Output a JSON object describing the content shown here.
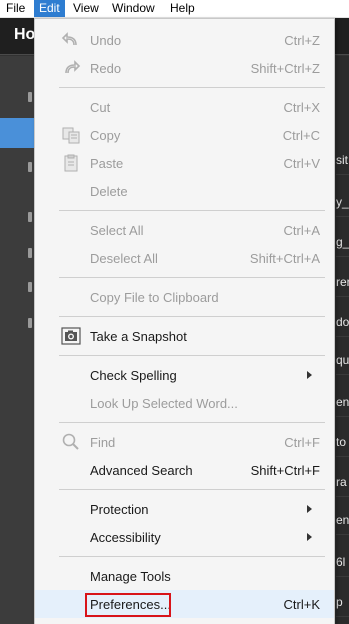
{
  "menubar": {
    "items": [
      "File",
      "Edit",
      "View",
      "Window",
      "Help"
    ]
  },
  "app": {
    "home_tab_label": "Ho",
    "right_fragments": [
      "sit",
      "y_",
      "g_",
      "ren",
      "do",
      "qu",
      "en",
      "to",
      "ra",
      "en",
      "6l",
      "p",
      "p",
      "en"
    ]
  },
  "menu": {
    "undo": {
      "label": "Undo",
      "shortcut": "Ctrl+Z"
    },
    "redo": {
      "label": "Redo",
      "shortcut": "Shift+Ctrl+Z"
    },
    "cut": {
      "label": "Cut",
      "shortcut": "Ctrl+X"
    },
    "copy": {
      "label": "Copy",
      "shortcut": "Ctrl+C"
    },
    "paste": {
      "label": "Paste",
      "shortcut": "Ctrl+V"
    },
    "delete": {
      "label": "Delete"
    },
    "select_all": {
      "label": "Select All",
      "shortcut": "Ctrl+A"
    },
    "deselect_all": {
      "label": "Deselect All",
      "shortcut": "Shift+Ctrl+A"
    },
    "copy_file": {
      "label": "Copy File to Clipboard"
    },
    "snapshot": {
      "label": "Take a Snapshot"
    },
    "check_spelling": {
      "label": "Check Spelling"
    },
    "look_up": {
      "label": "Look Up Selected Word..."
    },
    "find": {
      "label": "Find",
      "shortcut": "Ctrl+F"
    },
    "advanced_search": {
      "label": "Advanced Search",
      "shortcut": "Shift+Ctrl+F"
    },
    "protection": {
      "label": "Protection"
    },
    "accessibility": {
      "label": "Accessibility"
    },
    "manage_tools": {
      "label": "Manage Tools"
    },
    "preferences": {
      "label": "Preferences...",
      "shortcut": "Ctrl+K"
    }
  },
  "colors": {
    "menubar_active": "#2e7dd1",
    "highlight_row": "#e5f0fb",
    "focus_border": "#d8141a"
  },
  "icons": [
    "undo-icon",
    "redo-icon",
    "cut-icon",
    "copy-icon",
    "paste-icon",
    "camera-icon",
    "search-icon",
    "submenu-arrow-icon"
  ]
}
